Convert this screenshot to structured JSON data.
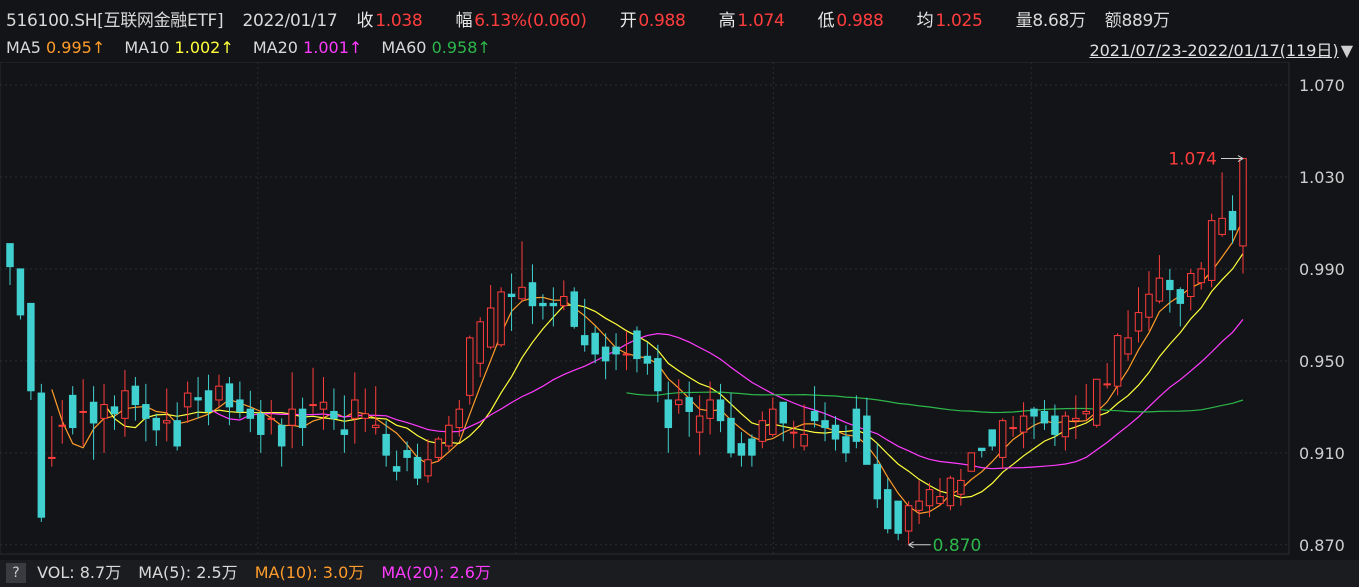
{
  "header": {
    "symbol": "516100.SH[互联网金融ETF]",
    "date": "2022/01/17",
    "close_label": "收",
    "close": "1.038",
    "change_label": "幅",
    "change": "6.13%(0.060)",
    "open_label": "开",
    "open": "0.988",
    "high_label": "高",
    "high": "1.074",
    "low_label": "低",
    "low": "0.988",
    "avg_label": "均",
    "avg": "1.025",
    "volume": "量8.68万",
    "amount": "额889万"
  },
  "ma_row": [
    {
      "label": "MA5",
      "value": "0.995↑",
      "color": "#ff9c2a"
    },
    {
      "label": "MA10",
      "value": "1.002↑",
      "color": "#ffff3b"
    },
    {
      "label": "MA20",
      "value": "1.001↑",
      "color": "#ff3bff"
    },
    {
      "label": "MA60",
      "value": "0.958↑",
      "color": "#2db74b"
    }
  ],
  "range": {
    "text": "2021/07/23-2022/01/17(119日)",
    "icon": "triangle-down-icon"
  },
  "chart_data": {
    "type": "candlestick",
    "y_ticks": [
      "1.070",
      "1.030",
      "0.990",
      "0.950",
      "0.910",
      "0.870"
    ],
    "ylim": [
      0.866,
      1.08
    ],
    "grid": true,
    "up_color": "#ff3d3d",
    "down_color": "#40d0d0",
    "annotations": {
      "high": "1.074",
      "low": "0.870"
    },
    "candles": [
      [
        1.001,
        1.001,
        0.991,
        0.983
      ],
      [
        0.99,
        0.99,
        0.97,
        0.968
      ],
      [
        0.975,
        0.975,
        0.937,
        0.933
      ],
      [
        0.936,
        0.94,
        0.882,
        0.88
      ],
      [
        0.908,
        0.926,
        0.908,
        0.904
      ],
      [
        0.922,
        0.933,
        0.922,
        0.914
      ],
      [
        0.935,
        0.939,
        0.921,
        0.918
      ],
      [
        0.928,
        0.942,
        0.928,
        0.913
      ],
      [
        0.932,
        0.939,
        0.923,
        0.907
      ],
      [
        0.925,
        0.94,
        0.931,
        0.91
      ],
      [
        0.93,
        0.935,
        0.927,
        0.92
      ],
      [
        0.925,
        0.946,
        0.937,
        0.917
      ],
      [
        0.939,
        0.943,
        0.931,
        0.924
      ],
      [
        0.931,
        0.94,
        0.925,
        0.915
      ],
      [
        0.925,
        0.927,
        0.92,
        0.913
      ],
      [
        0.923,
        0.938,
        0.924,
        0.915
      ],
      [
        0.924,
        0.932,
        0.913,
        0.911
      ],
      [
        0.93,
        0.941,
        0.936,
        0.923
      ],
      [
        0.934,
        0.943,
        0.933,
        0.925
      ],
      [
        0.937,
        0.944,
        0.928,
        0.922
      ],
      [
        0.933,
        0.944,
        0.939,
        0.93
      ],
      [
        0.94,
        0.943,
        0.93,
        0.922
      ],
      [
        0.933,
        0.941,
        0.928,
        0.925
      ],
      [
        0.929,
        0.937,
        0.925,
        0.919
      ],
      [
        0.927,
        0.933,
        0.918,
        0.91
      ],
      [
        0.925,
        0.933,
        0.925,
        0.918
      ],
      [
        0.922,
        0.925,
        0.913,
        0.904
      ],
      [
        0.922,
        0.945,
        0.929,
        0.912
      ],
      [
        0.929,
        0.934,
        0.921,
        0.913
      ],
      [
        0.931,
        0.947,
        0.931,
        0.927
      ],
      [
        0.929,
        0.943,
        0.932,
        0.92
      ],
      [
        0.928,
        0.938,
        0.925,
        0.92
      ],
      [
        0.92,
        0.935,
        0.918,
        0.91
      ],
      [
        0.925,
        0.945,
        0.933,
        0.914
      ],
      [
        0.925,
        0.938,
        0.927,
        0.919
      ],
      [
        0.921,
        0.939,
        0.922,
        0.918
      ],
      [
        0.918,
        0.924,
        0.909,
        0.904
      ],
      [
        0.904,
        0.911,
        0.902,
        0.898
      ],
      [
        0.911,
        0.915,
        0.908,
        0.902
      ],
      [
        0.908,
        0.914,
        0.899,
        0.896
      ],
      [
        0.9,
        0.916,
        0.907,
        0.897
      ],
      [
        0.908,
        0.917,
        0.916,
        0.906
      ],
      [
        0.913,
        0.926,
        0.922,
        0.911
      ],
      [
        0.921,
        0.933,
        0.929,
        0.917
      ],
      [
        0.935,
        0.961,
        0.96,
        0.931
      ],
      [
        0.949,
        0.969,
        0.967,
        0.943
      ],
      [
        0.956,
        0.983,
        0.973,
        0.955
      ],
      [
        0.957,
        0.982,
        0.98,
        0.956
      ],
      [
        0.979,
        0.988,
        0.978,
        0.963
      ],
      [
        0.977,
        1.002,
        0.982,
        0.976
      ],
      [
        0.984,
        0.992,
        0.974,
        0.966
      ],
      [
        0.975,
        0.979,
        0.974,
        0.968
      ],
      [
        0.975,
        0.982,
        0.974,
        0.965
      ],
      [
        0.974,
        0.985,
        0.978,
        0.972
      ],
      [
        0.98,
        0.982,
        0.965,
        0.964
      ],
      [
        0.961,
        0.977,
        0.957,
        0.954
      ],
      [
        0.962,
        0.965,
        0.953,
        0.949
      ],
      [
        0.956,
        0.962,
        0.95,
        0.942
      ],
      [
        0.956,
        0.962,
        0.953,
        0.946
      ],
      [
        0.953,
        0.963,
        0.953,
        0.946
      ],
      [
        0.963,
        0.965,
        0.951,
        0.945
      ],
      [
        0.952,
        0.958,
        0.949,
        0.944
      ],
      [
        0.951,
        0.957,
        0.937,
        0.932
      ],
      [
        0.933,
        0.941,
        0.921,
        0.91
      ],
      [
        0.931,
        0.942,
        0.933,
        0.927
      ],
      [
        0.934,
        0.941,
        0.928,
        0.917
      ],
      [
        0.919,
        0.935,
        0.926,
        0.909
      ],
      [
        0.925,
        0.941,
        0.933,
        0.918
      ],
      [
        0.933,
        0.94,
        0.924,
        0.919
      ],
      [
        0.925,
        0.936,
        0.91,
        0.908
      ],
      [
        0.914,
        0.919,
        0.909,
        0.904
      ],
      [
        0.916,
        0.918,
        0.909,
        0.904
      ],
      [
        0.915,
        0.928,
        0.924,
        0.912
      ],
      [
        0.918,
        0.934,
        0.929,
        0.917
      ],
      [
        0.932,
        0.932,
        0.923,
        0.915
      ],
      [
        0.919,
        0.924,
        0.919,
        0.912
      ],
      [
        0.913,
        0.931,
        0.918,
        0.911
      ],
      [
        0.928,
        0.939,
        0.924,
        0.921
      ],
      [
        0.924,
        0.932,
        0.921,
        0.915
      ],
      [
        0.922,
        0.926,
        0.916,
        0.911
      ],
      [
        0.917,
        0.922,
        0.91,
        0.906
      ],
      [
        0.929,
        0.935,
        0.915,
        0.912
      ],
      [
        0.926,
        0.934,
        0.905,
        0.905
      ],
      [
        0.905,
        0.914,
        0.89,
        0.886
      ],
      [
        0.894,
        0.899,
        0.877,
        0.875
      ],
      [
        0.889,
        0.889,
        0.875,
        0.872
      ],
      [
        0.876,
        0.889,
        0.887,
        0.87
      ],
      [
        0.885,
        0.898,
        0.889,
        0.879
      ],
      [
        0.887,
        0.897,
        0.894,
        0.882
      ],
      [
        0.888,
        0.899,
        0.891,
        0.887
      ],
      [
        0.887,
        0.9,
        0.899,
        0.885
      ],
      [
        0.892,
        0.903,
        0.898,
        0.887
      ],
      [
        0.902,
        0.906,
        0.91,
        0.906
      ],
      [
        0.912,
        0.911,
        0.911,
        0.908
      ],
      [
        0.92,
        0.919,
        0.913,
        0.911
      ],
      [
        0.908,
        0.925,
        0.924,
        0.903
      ],
      [
        0.921,
        0.926,
        0.921,
        0.917
      ],
      [
        0.919,
        0.932,
        0.926,
        0.912
      ],
      [
        0.929,
        0.93,
        0.926,
        0.916
      ],
      [
        0.928,
        0.933,
        0.923,
        0.92
      ],
      [
        0.926,
        0.931,
        0.918,
        0.913
      ],
      [
        0.917,
        0.928,
        0.926,
        0.911
      ],
      [
        0.924,
        0.935,
        0.925,
        0.916
      ],
      [
        0.927,
        0.94,
        0.928,
        0.924
      ],
      [
        0.922,
        0.941,
        0.942,
        0.921
      ],
      [
        0.94,
        0.949,
        0.94,
        0.938
      ],
      [
        0.939,
        0.962,
        0.961,
        0.935
      ],
      [
        0.953,
        0.972,
        0.96,
        0.95
      ],
      [
        0.963,
        0.982,
        0.971,
        0.958
      ],
      [
        0.969,
        0.989,
        0.979,
        0.963
      ],
      [
        0.976,
        0.996,
        0.986,
        0.975
      ],
      [
        0.985,
        0.99,
        0.981,
        0.971
      ],
      [
        0.981,
        0.982,
        0.975,
        0.965
      ],
      [
        0.978,
        0.99,
        0.988,
        0.972
      ],
      [
        0.984,
        0.993,
        0.99,
        0.981
      ],
      [
        0.985,
        1.014,
        1.011,
        0.982
      ],
      [
        1.005,
        1.032,
        1.012,
        1.004
      ],
      [
        1.015,
        1.022,
        1.007,
        1.001
      ],
      [
        1.0,
        1.038,
        1.038,
        0.988
      ]
    ]
  },
  "bottom_bar": {
    "help_icon": "?",
    "vol": "VOL: 8.7万",
    "ma5": "MA(5): 2.5万",
    "ma10": "MA(10): 3.0万",
    "ma20": "MA(20): 2.6万",
    "ma5_color": "#e8e8e8",
    "ma10_color": "#ff9c2a",
    "ma20_color": "#ff3bff"
  }
}
